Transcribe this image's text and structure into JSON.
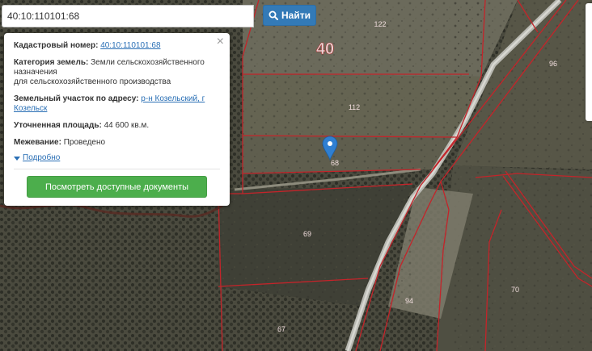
{
  "search": {
    "value": "40:10:110101:68",
    "button_label": "Найти",
    "button_icon": "search-icon"
  },
  "popup": {
    "cadastral_label": "Кадастровый номер:",
    "cadastral_value": "40:10:110101:68",
    "category_label": "Категория земель:",
    "category_value_1": "Земли сельскохозяйственного",
    "category_value_2": "назначения",
    "category_value_3": "для сельскохозяйственного производства",
    "address_label": "Земельный участок по адресу:",
    "address_value_1": "р-н Козельский, г",
    "address_value_2": "Козельск",
    "area_label": "Уточненная площадь:",
    "area_value": "44 600 кв.м.",
    "survey_label": "Межевание:",
    "survey_value": "Проведено",
    "details_label": "Подробно",
    "docs_button_label": "Посмотреть доступные документы",
    "close_symbol": "×"
  },
  "map": {
    "quarter_label": "40",
    "parcels": {
      "p122": "122",
      "p96": "96",
      "p112": "112",
      "p68": "68",
      "p69": "69",
      "p70": "70",
      "p94": "94",
      "p67": "67"
    },
    "colors": {
      "boundary": "#c4242a",
      "marker": "#2f7fd1",
      "button_blue": "#337ab7",
      "button_green": "#4cae4c"
    }
  }
}
